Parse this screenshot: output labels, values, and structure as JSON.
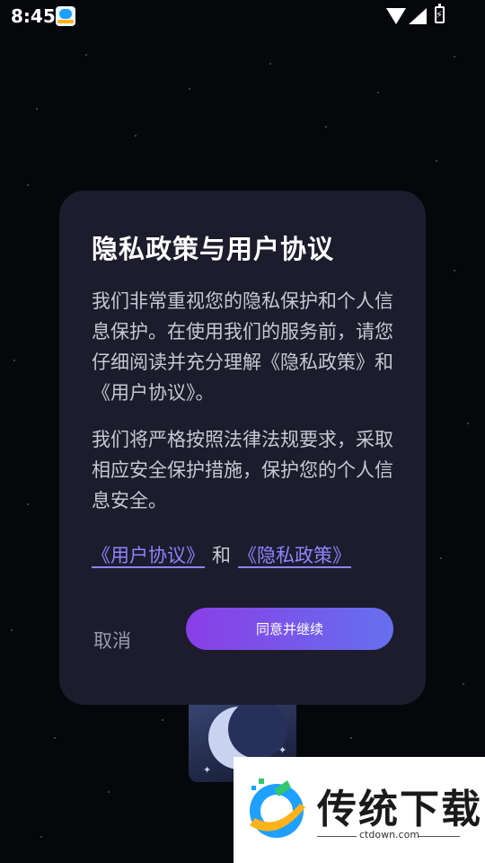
{
  "status_bar": {
    "time": "8:45",
    "icons": [
      "app-notification-icon",
      "wifi-icon",
      "signal-icon",
      "battery-charging-icon"
    ]
  },
  "dialog": {
    "title": "隐私政策与用户协议",
    "para1": "我们非常重视您的隐私保护和个人信息保护。在使用我们的服务前，请您仔细阅读并充分理解《隐私政策》和《用户协议》。",
    "para2": "我们将严格按照法律法规要求，采取相应安全保护措施，保护您的个人信息安全。",
    "link_user_agreement": "《用户协议》",
    "link_and": "和",
    "link_privacy_policy": "《隐私政策》",
    "cancel_label": "取消",
    "agree_label": "同意并继续"
  },
  "watermark": {
    "brand": "传统下载",
    "site": "ctdown.com"
  },
  "colors": {
    "background": "#06070b",
    "dialog_bg": "#1c1c2c",
    "link": "#8e83ff",
    "button_gradient_start": "#8a3ee6",
    "button_gradient_end": "#6570ee"
  }
}
